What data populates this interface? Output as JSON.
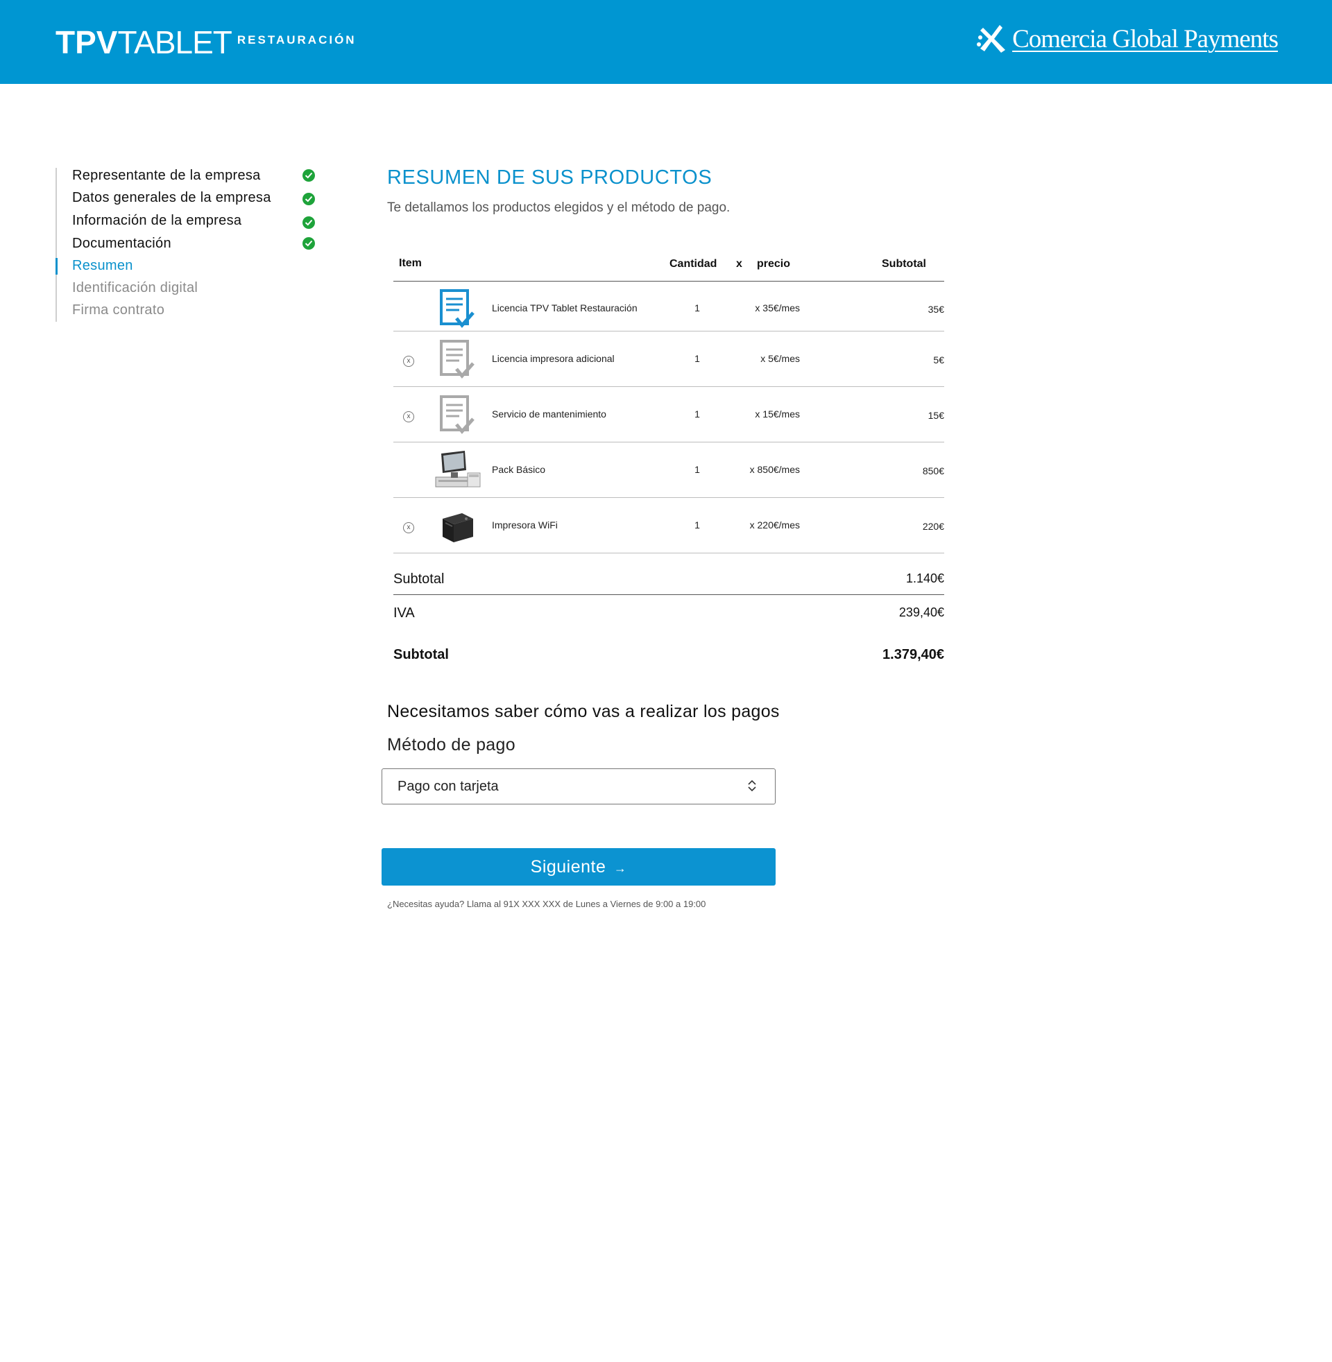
{
  "header": {
    "brand_strong": "TPV",
    "brand_light": "TABLET",
    "brand_sub": "RESTAURACIÓN",
    "partner_name": "Comercia Global Payments",
    "bg_color": "#0096d2"
  },
  "steps": [
    {
      "label": "Representante de la empresa",
      "state": "done"
    },
    {
      "label": "Datos generales de la empresa",
      "state": "done"
    },
    {
      "label": "Información de la empresa",
      "state": "done"
    },
    {
      "label": "Documentación",
      "state": "done"
    },
    {
      "label": "Resumen",
      "state": "active"
    },
    {
      "label": "Identificación digital",
      "state": "pending"
    },
    {
      "label": "Firma contrato",
      "state": "pending"
    }
  ],
  "summary": {
    "title": "RESUMEN DE SUS PRODUCTOS",
    "subtitle": "Te detallamos los productos elegidos y el método de pago.",
    "columns": {
      "item": "Item",
      "cantidad": "Cantidad",
      "x": "x",
      "precio": "precio",
      "subtotal": "Subtotal"
    },
    "items": [
      {
        "name": "Licencia TPV Tablet Restauración",
        "qty": "1",
        "price": "x 35€/mes",
        "subtotal": "35€",
        "removable": false,
        "icon": "license-icon-blue"
      },
      {
        "name": "Licencia impresora adicional",
        "qty": "1",
        "price": "x 5€/mes",
        "subtotal": "5€",
        "removable": true,
        "icon": "license-icon-gray"
      },
      {
        "name": "Servicio de mantenimiento",
        "qty": "1",
        "price": "x 15€/mes",
        "subtotal": "15€",
        "removable": true,
        "icon": "license-icon-gray"
      },
      {
        "name": "Pack Básico",
        "qty": "1",
        "price": "x 850€/mes",
        "subtotal": "850€",
        "removable": false,
        "icon": "pos-terminal-image"
      },
      {
        "name": "Impresora WiFi",
        "qty": "1",
        "price": "x 220€/mes",
        "subtotal": "220€",
        "removable": true,
        "icon": "printer-image"
      }
    ],
    "remove_glyph": "x",
    "subtotal_label": "Subtotal",
    "subtotal_value": "1.140€",
    "iva_label": "IVA",
    "iva_value": "239,40€",
    "total_label": "Subtotal",
    "total_value": "1.379,40€"
  },
  "payment": {
    "question": "Necesitamos saber cómo vas a realizar los pagos",
    "method_label": "Método de pago",
    "method_value": "Pago con tarjeta"
  },
  "actions": {
    "next_label": "Siguiente",
    "next_arrow": "→"
  },
  "help_text": "¿Necesitas ayuda? Llama al 91X XXX XXX de Lunes a Viernes de 9:00 a 19:00"
}
